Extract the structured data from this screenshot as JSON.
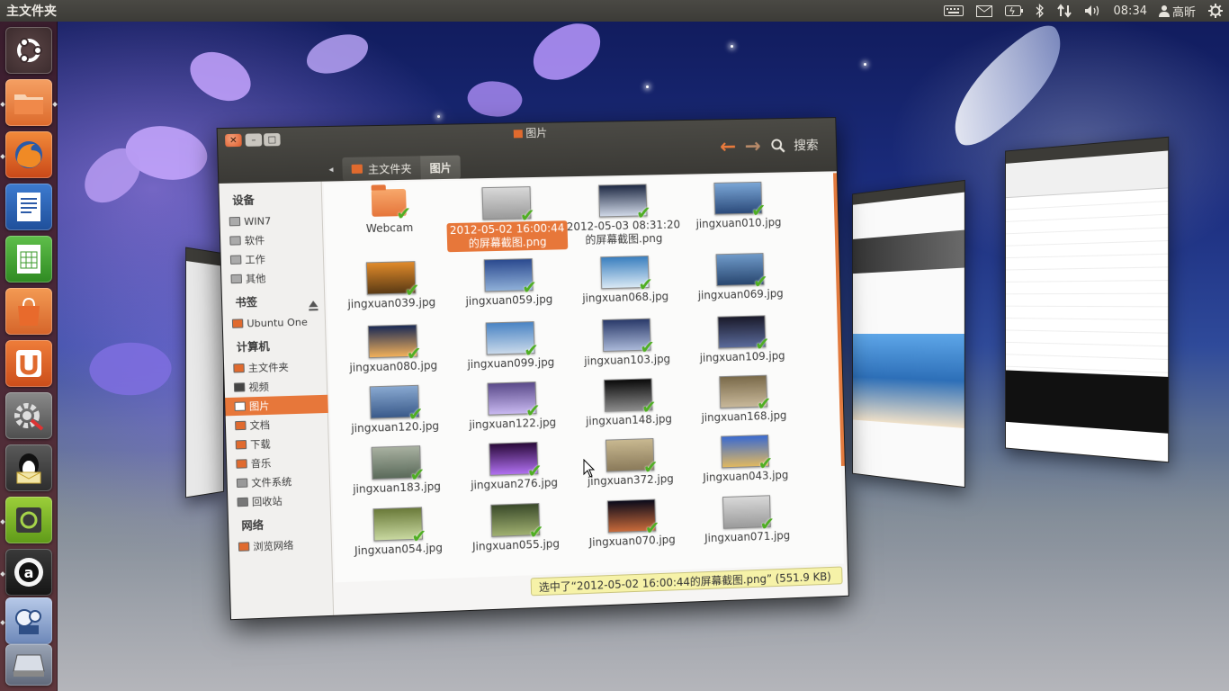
{
  "panel": {
    "title": "主文件夹",
    "clock": "08:34",
    "user": "高昕"
  },
  "launcher": {
    "items": [
      {
        "name": "ubuntu-dash",
        "icon": "ubuntu-logo-icon"
      },
      {
        "name": "home-folder",
        "icon": "folder-icon"
      },
      {
        "name": "firefox",
        "icon": "firefox-icon"
      },
      {
        "name": "writer",
        "icon": "libreoffice-writer-icon"
      },
      {
        "name": "calc",
        "icon": "libreoffice-calc-icon"
      },
      {
        "name": "software-center",
        "icon": "shopping-bag-icon"
      },
      {
        "name": "ubuntu-one",
        "icon": "ubuntu-one-icon"
      },
      {
        "name": "system-settings",
        "icon": "settings-wrench-icon"
      },
      {
        "name": "qq-mail",
        "icon": "penguin-mail-icon"
      },
      {
        "name": "workspace-switcher",
        "icon": "workspaces-icon"
      },
      {
        "name": "amarok",
        "icon": "amarok-icon"
      },
      {
        "name": "video",
        "icon": "video-player-icon"
      },
      {
        "name": "scanner",
        "icon": "scanner-icon"
      }
    ]
  },
  "window": {
    "title": "图片",
    "search_label": "搜索"
  },
  "pathbar": {
    "home": "主文件夹",
    "current": "图片"
  },
  "sidebar": {
    "devices_head": "设备",
    "devices": [
      "WIN7",
      "软件",
      "工作",
      "其他"
    ],
    "bookmarks_head": "书签",
    "bookmarks": [
      "Ubuntu One"
    ],
    "computer_head": "计算机",
    "computer": [
      "主文件夹",
      "视频",
      "图片",
      "文档",
      "下载",
      "音乐",
      "文件系统",
      "回收站"
    ],
    "network_head": "网络",
    "network": [
      "浏览网络"
    ]
  },
  "files": [
    {
      "name": "Webcam",
      "type": "folder"
    },
    {
      "name": "2012-05-02 16:00:44的屏幕截图.png",
      "selected": true
    },
    {
      "name": "2012-05-03 08:31:20的屏幕截图.png"
    },
    {
      "name": "jingxuan010.jpg"
    },
    {
      "name": "jingxuan039.jpg"
    },
    {
      "name": "jingxuan059.jpg"
    },
    {
      "name": "jingxuan068.jpg"
    },
    {
      "name": "jingxuan069.jpg"
    },
    {
      "name": "jingxuan080.jpg"
    },
    {
      "name": "jingxuan099.jpg"
    },
    {
      "name": "jingxuan103.jpg"
    },
    {
      "name": "jingxuan109.jpg"
    },
    {
      "name": "jingxuan120.jpg"
    },
    {
      "name": "jingxuan122.jpg"
    },
    {
      "name": "jingxuan148.jpg"
    },
    {
      "name": "jingxuan168.jpg"
    },
    {
      "name": "jingxuan183.jpg"
    },
    {
      "name": "jingxuan276.jpg"
    },
    {
      "name": "jingxuan372.jpg"
    },
    {
      "name": "Jingxuan043.jpg"
    },
    {
      "name": "Jingxuan054.jpg"
    },
    {
      "name": "Jingxuan055.jpg"
    },
    {
      "name": "Jingxuan070.jpg"
    },
    {
      "name": "Jingxuan071.jpg"
    }
  ],
  "status": "选中了“2012-05-02 16:00:44的屏幕截图.png” (551.9 KB)",
  "colors": {
    "accent": "#e7773a",
    "panel": "#3c3b37",
    "check": "#4fae23",
    "status_bg": "#f6f2a8"
  }
}
